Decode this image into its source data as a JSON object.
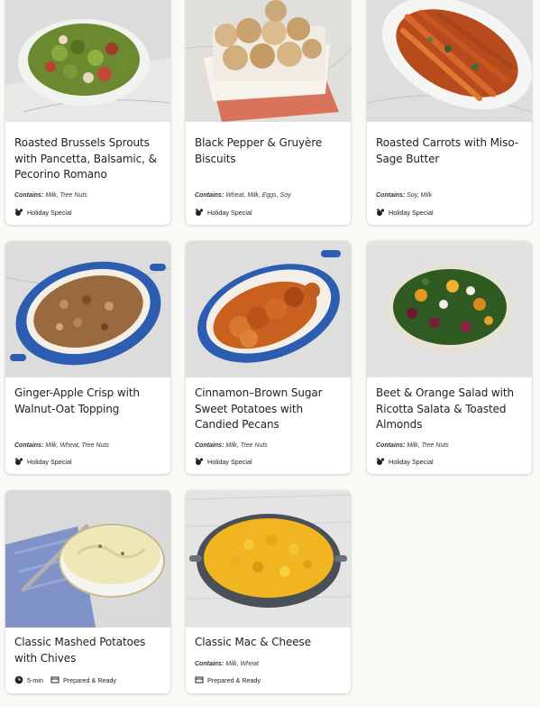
{
  "cards": [
    {
      "title": "Roasted Brussels Sprouts with Pancetta, Balsamic, & Pecorino Romano",
      "contains_label": "Contains:",
      "contains": "Milk, Tree Nuts",
      "tag": "Holiday Special"
    },
    {
      "title": "Black Pepper & Gruyère Biscuits",
      "contains_label": "Contains:",
      "contains": "Wheat, Milk, Eggs, Soy",
      "tag": "Holiday Special"
    },
    {
      "title": "Roasted Carrots with Miso-Sage Butter",
      "contains_label": "Contains:",
      "contains": "Soy, Milk",
      "tag": "Holiday Special"
    },
    {
      "title": "Ginger-Apple Crisp with Walnut-Oat Topping",
      "contains_label": "Contains:",
      "contains": "Milk, Wheat, Tree Nuts",
      "tag": "Holiday Special"
    },
    {
      "title": "Cinnamon–Brown Sugar Sweet Potatoes with Candied Pecans",
      "contains_label": "Contains:",
      "contains": "Milk, Tree Nuts",
      "tag": "Holiday Special"
    },
    {
      "title": "Beet & Orange Salad with Ricotta Salata & Toasted Almonds",
      "contains_label": "Contains:",
      "contains": "Milk, Tree Nuts",
      "tag": "Holiday Special"
    },
    {
      "title": "Classic Mashed Potatoes with Chives",
      "time": "5-min",
      "tag": "Prepared & Ready"
    },
    {
      "title": "Classic Mac & Cheese",
      "contains_label": "Contains:",
      "contains": "Milk, Wheat",
      "tag": "Prepared & Ready"
    }
  ]
}
